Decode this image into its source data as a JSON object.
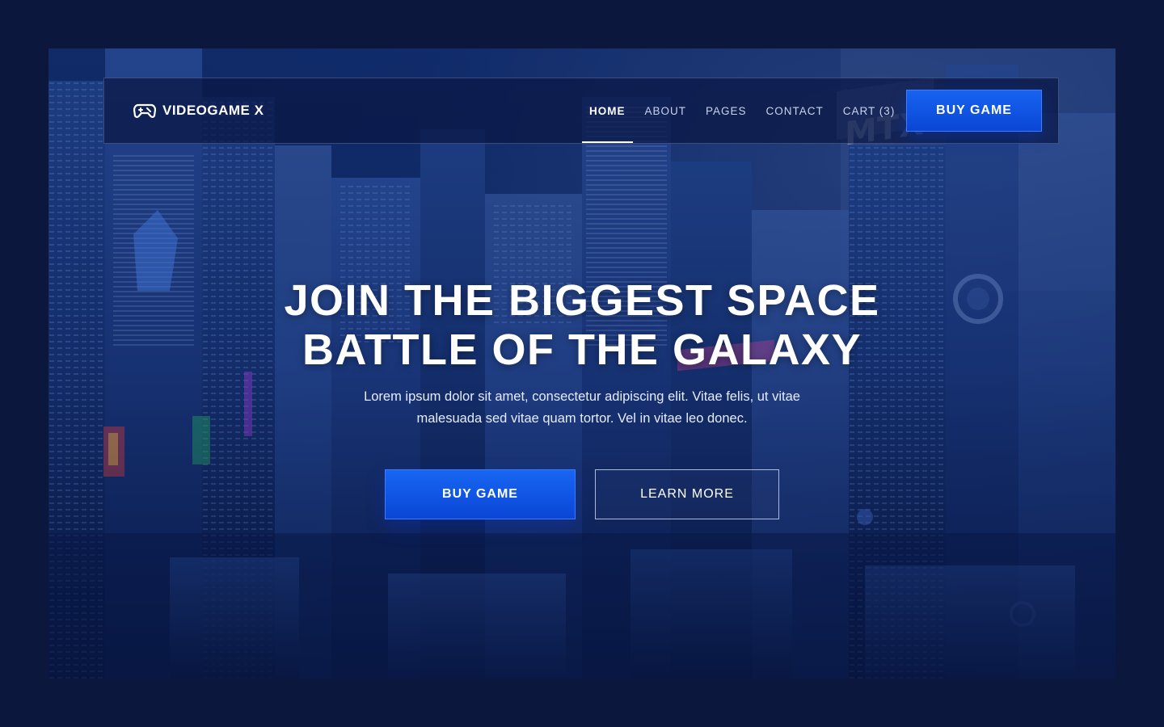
{
  "brand": {
    "name": "VIDEOGAME X",
    "logo_icon": "gamepad-icon"
  },
  "nav": {
    "items": [
      {
        "label": "HOME",
        "active": true
      },
      {
        "label": "ABOUT",
        "active": false
      },
      {
        "label": "PAGES",
        "active": false
      },
      {
        "label": "CONTACT",
        "active": false
      },
      {
        "label": "CART (3)",
        "active": false
      }
    ],
    "buy_label": "BUY GAME"
  },
  "hero": {
    "headline_line1": "JOIN THE BIGGEST SPACE",
    "headline_line2": "BATTLE OF THE GALAXY",
    "subtext_line1": "Lorem ipsum dolor sit amet, consectetur adipiscing elit. Vitae felis, ut vitae",
    "subtext_line2": "malesuada sed vitae quam tortor. Vel in vitae leo donec.",
    "primary_cta": "BUY GAME",
    "secondary_cta": "LEARN MORE"
  },
  "colors": {
    "page_bg": "#0c173d",
    "accent": "#1563f0",
    "text": "#ffffff"
  }
}
